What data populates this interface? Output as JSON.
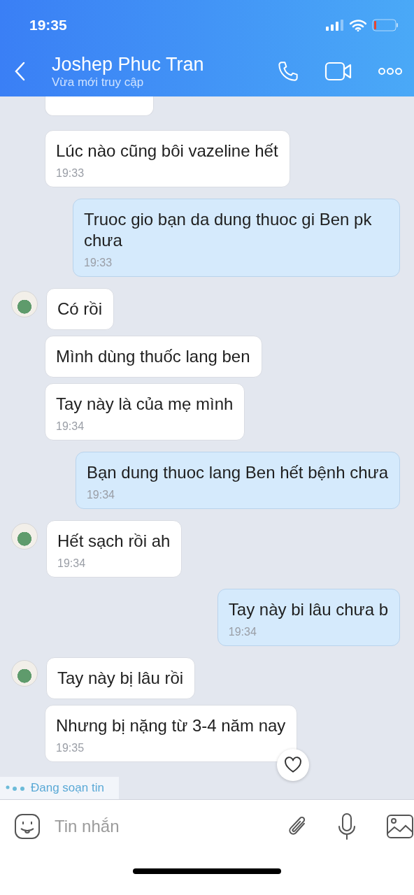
{
  "status_bar": {
    "time": "19:35"
  },
  "header": {
    "title": "Joshep Phuc Tran",
    "subtitle": "Vừa mới truy cập"
  },
  "messages": [
    {
      "kind": "fragment",
      "avatar": false
    },
    {
      "kind": "received",
      "avatar": false,
      "text": "Lúc nào cũng bôi vazeline hết",
      "time": "19:33"
    },
    {
      "kind": "sent",
      "text": "Truoc gio bạn da dung thuoc gi Ben pk chưa",
      "time": "19:33"
    },
    {
      "kind": "received",
      "avatar": true,
      "text": "Có rồi"
    },
    {
      "kind": "received",
      "avatar": false,
      "text": "Mình dùng thuốc lang ben"
    },
    {
      "kind": "received",
      "avatar": false,
      "text": "Tay này là của mẹ mình",
      "time": "19:34"
    },
    {
      "kind": "sent",
      "text": "Bạn dung thuoc lang Ben hết bệnh chưa",
      "time": "19:34"
    },
    {
      "kind": "received",
      "avatar": true,
      "text": "Hết sạch rồi ah",
      "time": "19:34"
    },
    {
      "kind": "sent",
      "text": "Tay này bi lâu chưa b",
      "time": "19:34"
    },
    {
      "kind": "received",
      "avatar": true,
      "text": "Tay này bị lâu rồi"
    },
    {
      "kind": "received",
      "avatar": false,
      "text": "Nhưng bị nặng từ 3-4 năm nay",
      "time": "19:35",
      "reaction": true
    }
  ],
  "typing": {
    "text": "Đang soạn tin"
  },
  "composer": {
    "placeholder": "Tin nhắn"
  }
}
